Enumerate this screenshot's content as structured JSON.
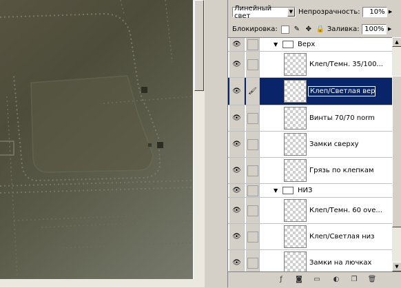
{
  "panel": {
    "blend_mode": "Линейный свет",
    "opacity_label": "Непрозрачность:",
    "opacity_value": "10%",
    "lock_label": "Блокировка:",
    "fill_label": "Заливка:",
    "fill_value": "100%"
  },
  "layers": [
    {
      "kind": "group",
      "name": "Верх",
      "expanded": true
    },
    {
      "kind": "layer",
      "name": "Клеп/Темн. 35/100...",
      "visible": true
    },
    {
      "kind": "layer",
      "name": "Клеп/Светлая верх",
      "visible": true,
      "selected": true,
      "editing": true
    },
    {
      "kind": "layer",
      "name": "Винты 70/70 norm",
      "visible": true
    },
    {
      "kind": "layer",
      "name": "Замки сверху",
      "visible": true
    },
    {
      "kind": "layer",
      "name": "Грязь по клепкам",
      "visible": true
    },
    {
      "kind": "group",
      "name": "НИЗ",
      "expanded": true
    },
    {
      "kind": "layer",
      "name": "Клеп/Темн. 60 ove...",
      "visible": true
    },
    {
      "kind": "layer",
      "name": "Клеп/Светлая низ",
      "visible": true
    },
    {
      "kind": "layer",
      "name": "Замки на лючках",
      "visible": true
    }
  ],
  "icons": {
    "eye": "eye-icon",
    "brush": "brush-icon",
    "folder": "folder-icon",
    "expand": "triangle-down-icon"
  },
  "colors": {
    "selection": "#0a246a",
    "panel_bg": "#d4d0c8"
  }
}
